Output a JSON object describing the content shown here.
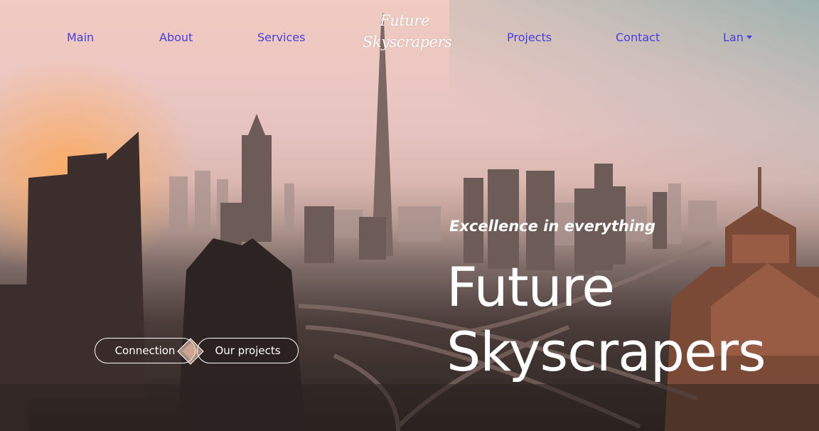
{
  "nav": {
    "main": "Main",
    "about": "About",
    "services": "Services",
    "projects": "Projects",
    "contact": "Contact",
    "language": "Lan"
  },
  "logo": {
    "line1": "Future",
    "line2": "Skyscrapers"
  },
  "hero": {
    "tagline": "Excellence in everything",
    "headline_line1": "Future",
    "headline_line2": "Skyscrapers"
  },
  "buttons": {
    "connection": "Connection",
    "projects": "Our projects"
  },
  "colors": {
    "nav_link": "#4a3de0",
    "text_light": "#ffffff"
  },
  "icons": {
    "language_dropdown": "caret-down-icon",
    "button_ornament": "diamond-icon"
  }
}
